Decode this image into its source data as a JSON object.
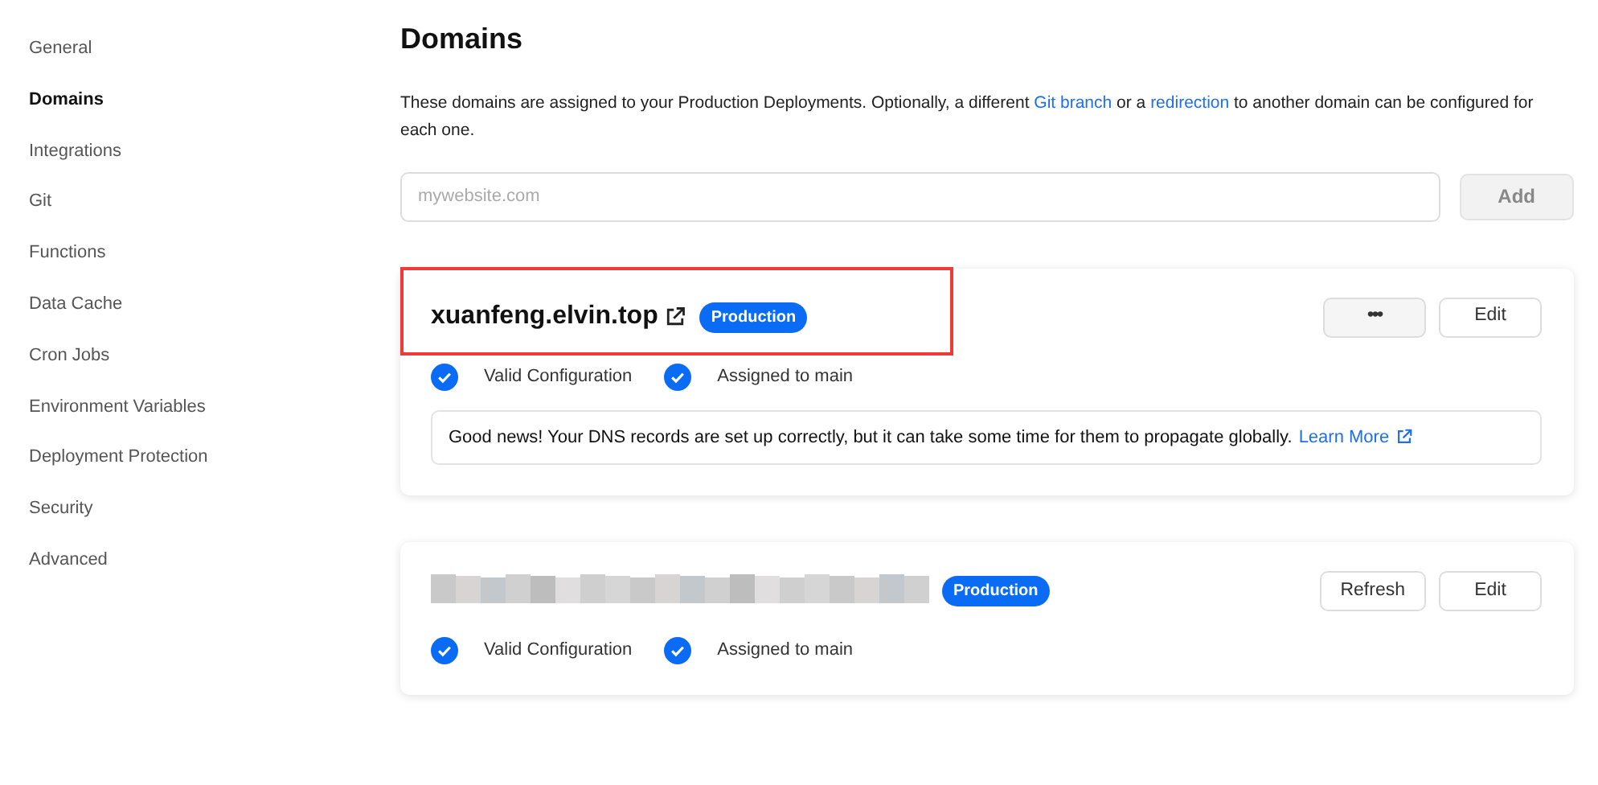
{
  "sidebar": {
    "items": [
      {
        "label": "General",
        "selected": false
      },
      {
        "label": "Domains",
        "selected": true
      },
      {
        "label": "Integrations",
        "selected": false
      },
      {
        "label": "Git",
        "selected": false
      },
      {
        "label": "Functions",
        "selected": false
      },
      {
        "label": "Data Cache",
        "selected": false
      },
      {
        "label": "Cron Jobs",
        "selected": false
      },
      {
        "label": "Environment Variables",
        "selected": false
      },
      {
        "label": "Deployment Protection",
        "selected": false
      },
      {
        "label": "Security",
        "selected": false
      },
      {
        "label": "Advanced",
        "selected": false
      }
    ]
  },
  "page": {
    "title": "Domains",
    "description": [
      {
        "kind": "text",
        "text": "These domains are assigned to your Production Deployments. Optionally, a different "
      },
      {
        "kind": "link",
        "text": "Git branch"
      },
      {
        "kind": "text",
        "text": " or a "
      },
      {
        "kind": "link",
        "text": "redirection"
      },
      {
        "kind": "text",
        "text": " to another domain can be configured for each one."
      }
    ],
    "input": {
      "placeholder": "mywebsite.com"
    },
    "add_button": "Add"
  },
  "domains": [
    {
      "name": "xuanfeng.elvin.top",
      "redacted": false,
      "highlighted": true,
      "badge": "Production",
      "buttons": [
        {
          "kind": "more",
          "label": "•••"
        },
        {
          "kind": "text",
          "label": "Edit"
        }
      ],
      "checks": [
        "Valid Configuration",
        "Assigned to main"
      ],
      "note": {
        "text": "Good news! Your DNS records are set up correctly, but it can take some time for them to propagate globally.",
        "link": "Learn More"
      }
    },
    {
      "redacted": true,
      "highlighted": false,
      "badge": "Production",
      "buttons": [
        {
          "kind": "text",
          "label": "Refresh"
        },
        {
          "kind": "text",
          "label": "Edit"
        }
      ],
      "checks": [
        "Valid Configuration",
        "Assigned to main"
      ]
    }
  ]
}
